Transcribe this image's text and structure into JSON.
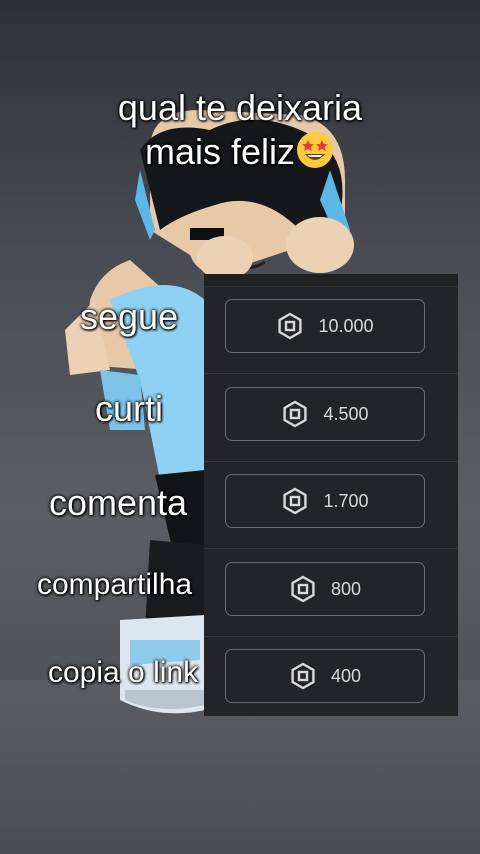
{
  "title": {
    "line1": "qual te deixaria",
    "line2": "mais feliz"
  },
  "emoji_icon": "star-struck-emoji",
  "currency_icon": "robux-icon",
  "rows": [
    {
      "label": "segue",
      "amount": "10.000"
    },
    {
      "label": "curti",
      "amount": "4.500"
    },
    {
      "label": "comenta",
      "amount": "1.700"
    },
    {
      "label": "compartilha",
      "amount": "800"
    },
    {
      "label": "copia o link",
      "amount": "400"
    }
  ]
}
